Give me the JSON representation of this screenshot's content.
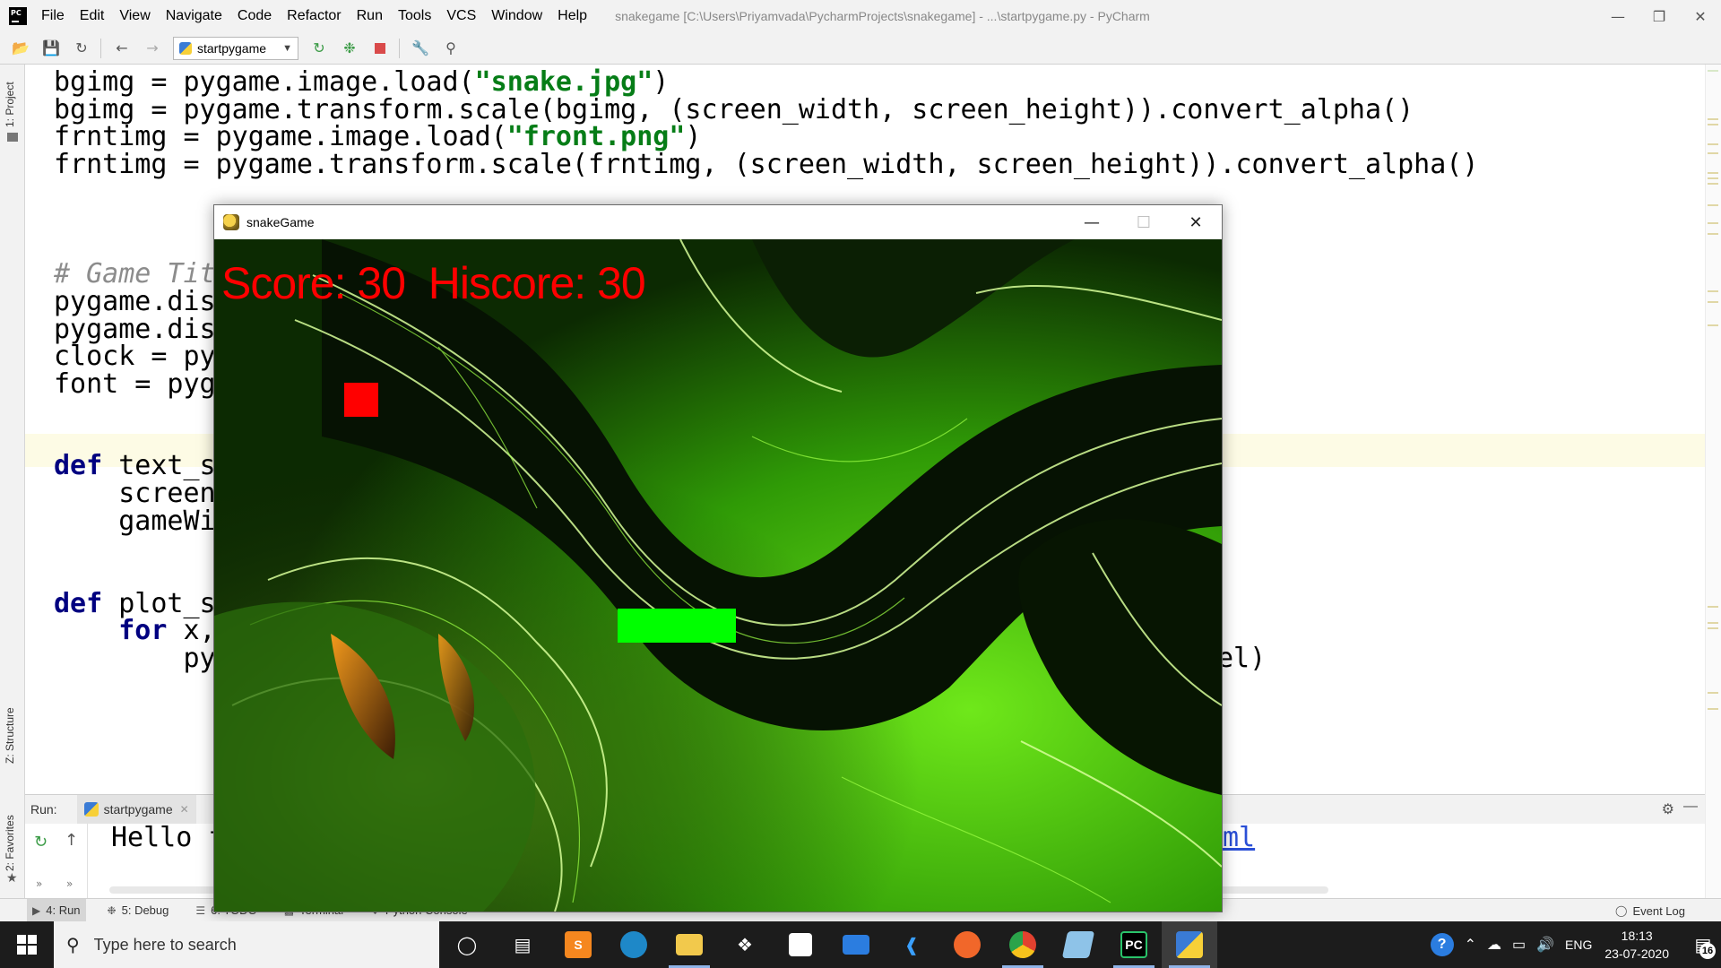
{
  "ide": {
    "logo": "PC",
    "menu": [
      "File",
      "Edit",
      "View",
      "Navigate",
      "Code",
      "Refactor",
      "Run",
      "Tools",
      "VCS",
      "Window",
      "Help"
    ],
    "window_title": "snakegame [C:\\Users\\Priyamvada\\PycharmProjects\\snakegame] - ...\\startpygame.py - PyCharm",
    "run_config": "startpygame",
    "left_tabs": {
      "project": "1: Project",
      "structure": "Z: Structure",
      "favorites": "2: Favorites"
    },
    "editor": {
      "line1": {
        "a": "bgimg = pygame.image.load(",
        "s": "\"snake.jpg\"",
        "b": ")"
      },
      "line2": "bgimg = pygame.transform.scale(bgimg, (screen_width, screen_height)).convert_alpha()",
      "line3": {
        "a": "frntimg = pygame.image.load(",
        "s": "\"front.png\"",
        "b": ")"
      },
      "line4": "frntimg = pygame.transform.scale(frntimg, (screen_width, screen_height)).convert_alpha()",
      "line5": "# Game Tit",
      "line6": "pygame.dis",
      "line7": "pygame.dis",
      "line8": "clock = py",
      "line9": "font = pyg",
      "line10": {
        "kw": "def",
        "rest": " text_s"
      },
      "line11": "    screen",
      "line12": "    gameWi",
      "line13": {
        "kw": "def",
        "rest": " plot_s"
      },
      "line14": {
        "kw": "for",
        "rest": " x,"
      },
      "line15": "py",
      "line15_tail": "el)"
    },
    "run_panel": {
      "label": "Run:",
      "tab": "startpygame",
      "console_text": "Hello f",
      "console_link": "ml"
    },
    "tool_tabs": [
      "4: Run",
      "5: Debug",
      "6: TODO",
      "Terminal",
      "Python Console"
    ],
    "event_log": "Event Log"
  },
  "game": {
    "window_title": "snakeGame",
    "score_text": "Score: 30  Hiscore: 30",
    "colors": {
      "food": "#ff0000",
      "snake": "#00ff00",
      "score": "#ff0000"
    }
  },
  "taskbar": {
    "search_placeholder": "Type here to search",
    "apps": [
      "cortana-icon",
      "task-view-icon",
      "sublime-icon",
      "edge-icon",
      "file-explorer-icon",
      "dropbox-icon",
      "store-icon",
      "mail-icon",
      "vscode-icon",
      "firefox-icon",
      "chrome-icon",
      "notepad-icon",
      "pycharm-icon",
      "python-icon"
    ],
    "lang": "ENG",
    "time": "18:13",
    "date": "23-07-2020",
    "notifications": "16"
  }
}
